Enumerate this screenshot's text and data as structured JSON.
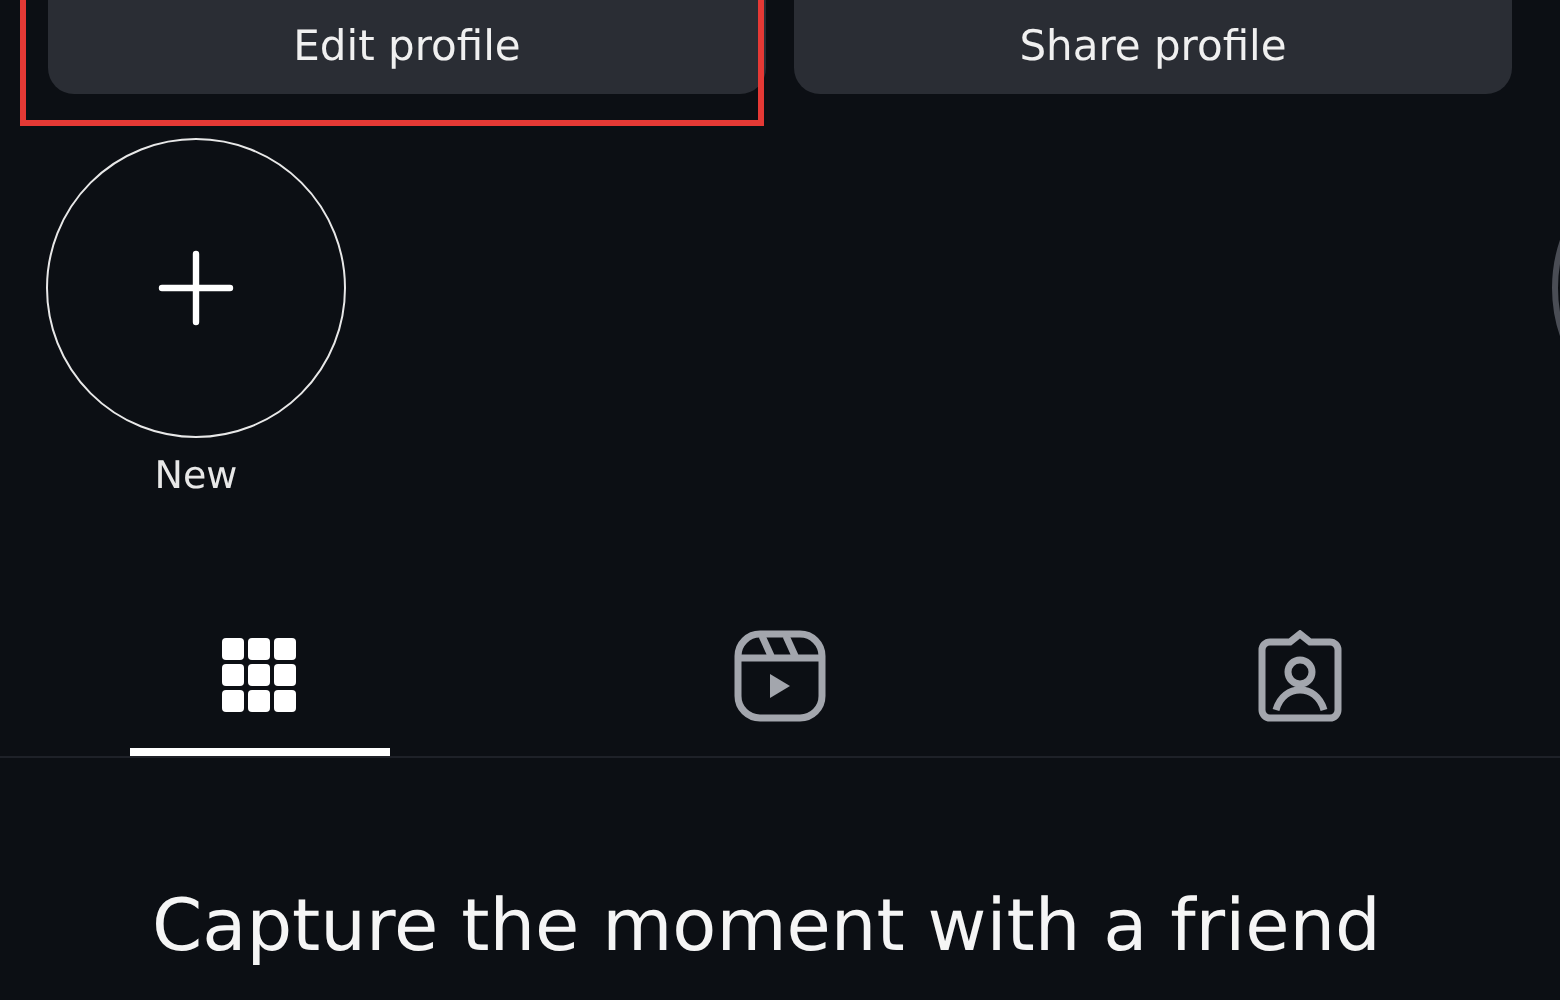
{
  "profile_buttons": [
    {
      "label": "Edit profile",
      "highlighted": true
    },
    {
      "label": "Share profile",
      "highlighted": false
    }
  ],
  "highlights": [
    {
      "kind": "new",
      "label": "New"
    },
    {
      "kind": "story"
    }
  ],
  "tabs": [
    {
      "kind": "grid",
      "selected": true
    },
    {
      "kind": "reels",
      "selected": false
    },
    {
      "kind": "tagged",
      "selected": false
    }
  ],
  "empty_state": {
    "title": "Capture the moment with a friend"
  }
}
